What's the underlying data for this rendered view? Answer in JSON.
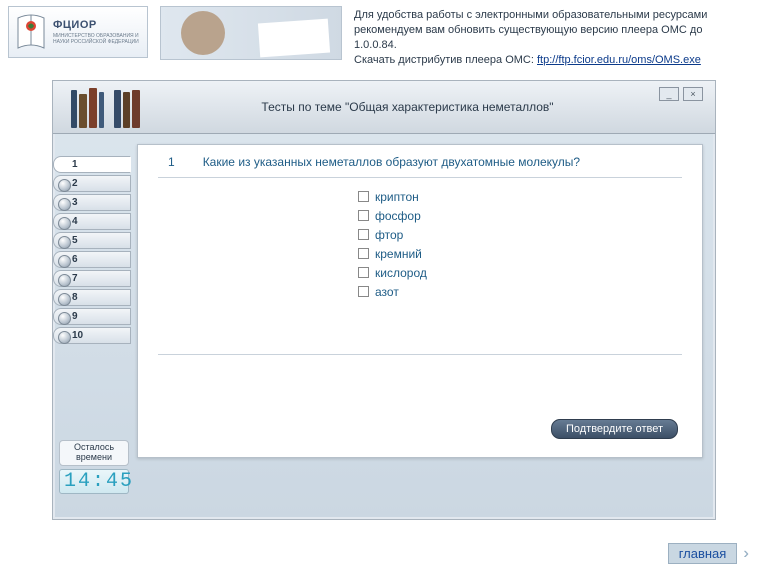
{
  "logo": {
    "acronym": "ФЦИОР",
    "subtitle": "МИНИСТЕРСТВО ОБРАЗОВАНИЯ И НАУКИ РОССИЙСКОЙ ФЕДЕРАЦИИ"
  },
  "notice": {
    "line1": "Для удобства работы с электронными образовательными ресурсами рекомендуем вам обновить существующую версию плеера ОМС до 1.0.0.84.",
    "line2_prefix": "Скачать дистрибутив плеера ОМС: ",
    "link_text": "ftp://ftp.fcior.edu.ru/oms/OMS.exe"
  },
  "player": {
    "title": "Тесты по теме \"Общая характеристика неметаллов\"",
    "window": {
      "min": "_",
      "close": "×"
    }
  },
  "question": {
    "number": "1",
    "text": "Какие из указанных неметаллов образуют двухатомные молекулы?",
    "options": [
      "криптон",
      "фосфор",
      "фтор",
      "кремний",
      "кислород",
      "азот"
    ],
    "confirm": "Подтвердите ответ"
  },
  "tabs": [
    "1",
    "2",
    "3",
    "4",
    "5",
    "6",
    "7",
    "8",
    "9",
    "10"
  ],
  "active_tab": "1",
  "timer": {
    "label": "Осталось времени",
    "value": "14:45"
  },
  "main_link": {
    "label": "главная"
  }
}
